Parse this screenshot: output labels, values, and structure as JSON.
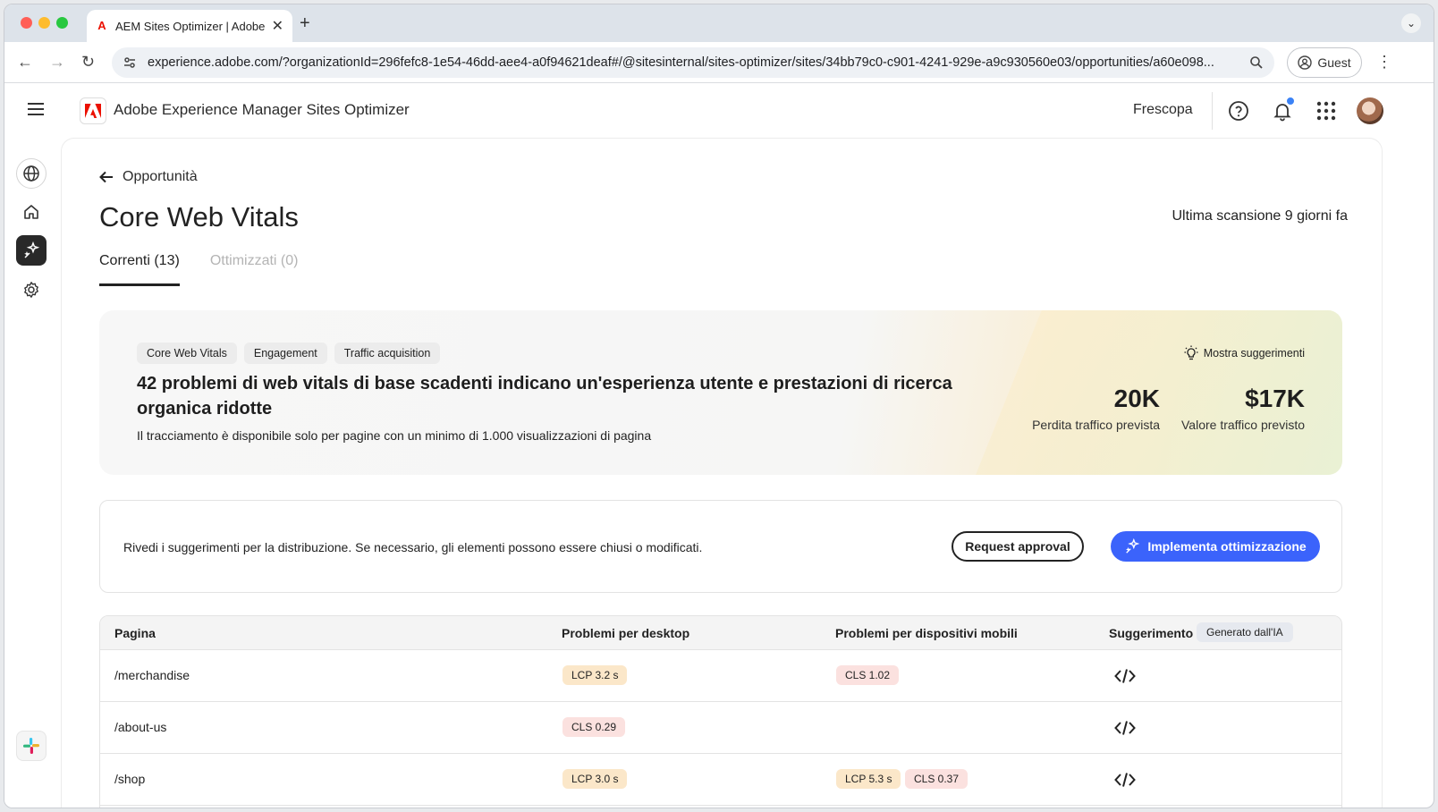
{
  "browser": {
    "tab_title": "AEM Sites Optimizer | Adobe",
    "url": "experience.adobe.com/?organizationId=296fefc8-1e54-46dd-aee4-a0f94621deaf#/@sitesinternal/sites-optimizer/sites/34bb79c0-c901-4241-929e-a9c930560e03/opportunities/a60e098...",
    "profile_label": "Guest"
  },
  "header": {
    "app_title": "Adobe Experience Manager Sites Optimizer",
    "org_name": "Frescopa"
  },
  "page": {
    "back_label": "Opportunità",
    "title": "Core Web Vitals",
    "last_scan": "Ultima scansione 9 giorni fa",
    "tabs": [
      {
        "label": "Correnti (13)",
        "active": true
      },
      {
        "label": "Ottimizzati (0)",
        "active": false
      }
    ]
  },
  "hero": {
    "chips": [
      "Core Web Vitals",
      "Engagement",
      "Traffic acquisition"
    ],
    "suggestions_label": "Mostra suggerimenti",
    "title": "42 problemi di web vitals di base scadenti indicano un'esperienza utente e prestazioni di ricerca organica ridotte",
    "subtitle": "Il tracciamento è disponibile solo per pagine con un minimo di 1.000 visualizzazioni di pagina",
    "metrics": [
      {
        "value": "20K",
        "label": "Perdita traffico prevista"
      },
      {
        "value": "$17K",
        "label": "Valore traffico previsto"
      }
    ]
  },
  "actions": {
    "text": "Rivedi i suggerimenti per la distribuzione. Se necessario, gli elementi possono essere chiusi o modificati.",
    "request_label": "Request approval",
    "deploy_label": "Implementa ottimizzazione"
  },
  "table": {
    "headers": {
      "page": "Pagina",
      "desktop": "Problemi per desktop",
      "mobile": "Problemi per dispositivi mobili",
      "suggestion": "Suggerimento",
      "ai_badge": "Generato dall'IA"
    },
    "rows": [
      {
        "page": "/merchandise",
        "desktop": [
          "LCP 3.2 s"
        ],
        "mobile": [
          "CLS 1.02"
        ]
      },
      {
        "page": "/about-us",
        "desktop": [
          "CLS 0.29"
        ],
        "mobile": []
      },
      {
        "page": "/shop",
        "desktop": [
          "LCP 3.0 s"
        ],
        "mobile": [
          "LCP 5.3 s",
          "CLS 0.37"
        ]
      }
    ]
  },
  "colors": {
    "primary_button": "#3b63fb",
    "notification_dot": "#3b82f6",
    "lcp_pill": "#fbe7c9",
    "cls_pill": "#fbe1df"
  }
}
